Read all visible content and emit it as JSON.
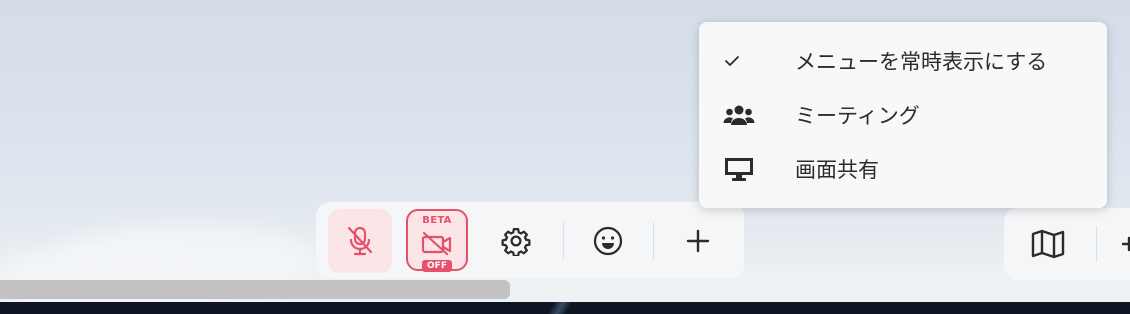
{
  "menu": {
    "items": [
      {
        "label": "メニューを常時表示にする",
        "icon": "checkmark-icon",
        "checked": true
      },
      {
        "label": "ミーティング",
        "icon": "people-group-icon"
      },
      {
        "label": "画面共有",
        "icon": "monitor-icon"
      }
    ]
  },
  "toolbar": {
    "mic": {
      "icon": "microphone-off-icon",
      "state": "muted"
    },
    "camera": {
      "icon": "camera-off-icon",
      "badge_top": "BETA",
      "badge_bottom": "OFF"
    },
    "settings": {
      "icon": "gear-icon"
    },
    "emoji": {
      "icon": "smiley-icon"
    },
    "add": {
      "icon": "plus-icon"
    }
  },
  "toolbar_secondary": {
    "map": {
      "icon": "map-icon"
    }
  },
  "colors": {
    "accent_red": "#e5506b",
    "muted_bg": "#fbe5e7",
    "menu_bg": "#f7f8fa",
    "toolbar_bg": "#f5f6f8"
  }
}
